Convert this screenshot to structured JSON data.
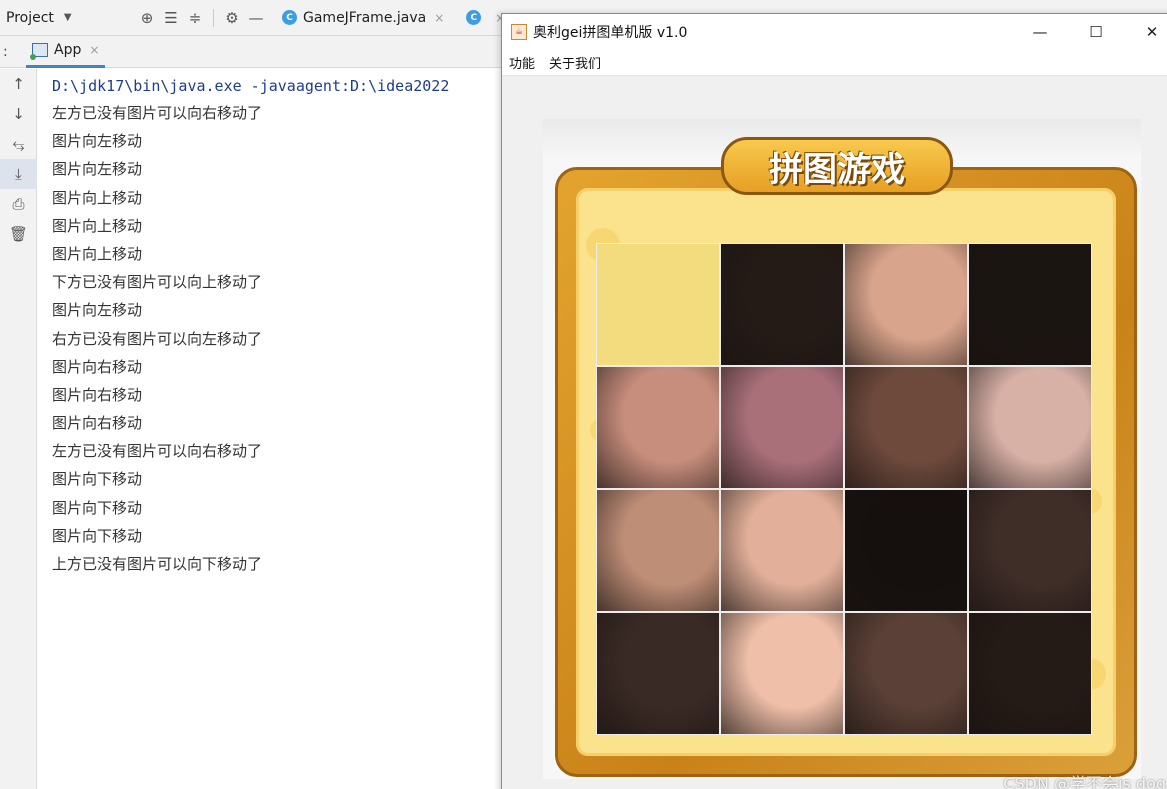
{
  "ide": {
    "project_label": "Project",
    "tabs": [
      {
        "label": "GameJFrame.java",
        "close": "×"
      },
      {
        "label": "",
        "close": "×"
      }
    ],
    "run_tab": {
      "prefix": ":",
      "label": "App",
      "close": "×"
    },
    "console": {
      "command": "D:\\jdk17\\bin\\java.exe -javaagent:D:\\idea2022",
      "lines": [
        "左方已没有图片可以向右移动了",
        "图片向左移动",
        "图片向左移动",
        "图片向上移动",
        "图片向上移动",
        "图片向上移动",
        "下方已没有图片可以向上移动了",
        "图片向左移动",
        "右方已没有图片可以向左移动了",
        "图片向右移动",
        "图片向右移动",
        "图片向右移动",
        "左方已没有图片可以向右移动了",
        "图片向下移动",
        "图片向下移动",
        "图片向下移动",
        "上方已没有图片可以向下移动了"
      ]
    }
  },
  "game": {
    "window_title": "奥利gei拼图单机版 v1.0",
    "menu": [
      "功能",
      "关于我们"
    ],
    "banner": "拼图游戏",
    "tiles": [
      {
        "c": "#f3dc7d"
      },
      {
        "c": "#241b17"
      },
      {
        "c": "#d9a48c"
      },
      {
        "c": "#1b1512"
      },
      {
        "c": "#c88e7d"
      },
      {
        "c": "#a9707a"
      },
      {
        "c": "#6e4a3d"
      },
      {
        "c": "#d7b0a6"
      },
      {
        "c": "#bf8e77"
      },
      {
        "c": "#e2b09a"
      },
      {
        "c": "#150f0d"
      },
      {
        "c": "#3f2d28"
      },
      {
        "c": "#3a2a25"
      },
      {
        "c": "#efbfa9"
      },
      {
        "c": "#5a4036"
      },
      {
        "c": "#241a16"
      }
    ]
  },
  "watermark": "CSDN @学不会is dog"
}
